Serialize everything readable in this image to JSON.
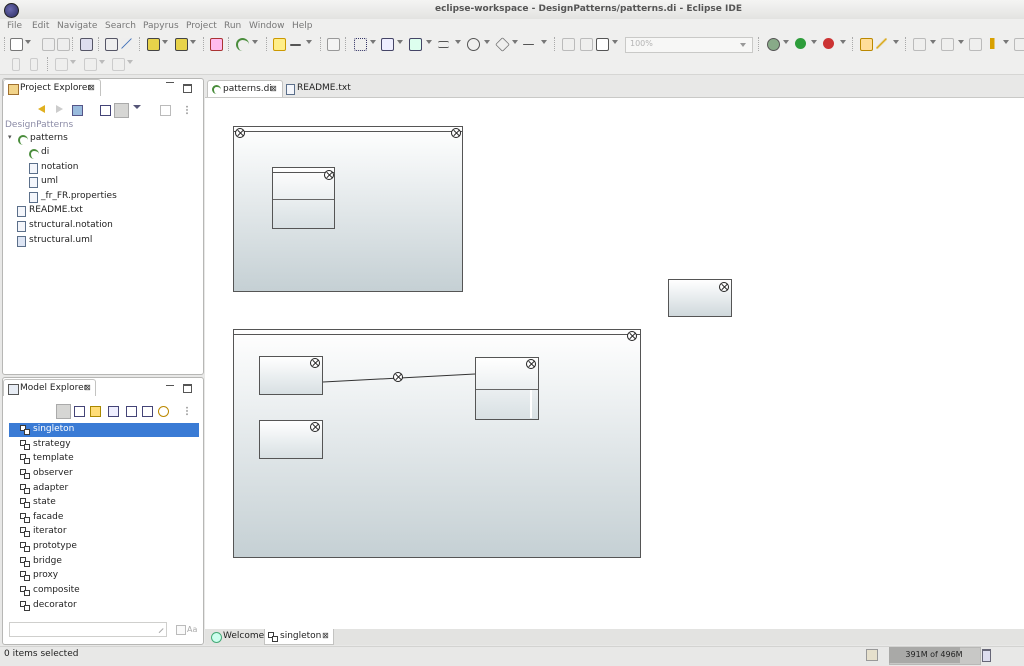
{
  "window": {
    "title": "eclipse-workspace - DesignPatterns/patterns.di - Eclipse IDE"
  },
  "menu": [
    "File",
    "Edit",
    "Navigate",
    "Search",
    "Papyrus",
    "Project",
    "Run",
    "Window",
    "Help"
  ],
  "toolbar": {
    "zoom_value": "100%"
  },
  "project_explorer": {
    "tab_label": "Project Explorer",
    "project_name": "DesignPatterns",
    "tree": [
      {
        "label": "patterns",
        "icon": "di-icon",
        "indent": 0,
        "expanded": true
      },
      {
        "label": "di",
        "icon": "di-icon",
        "indent": 1
      },
      {
        "label": "notation",
        "icon": "file-icon",
        "indent": 1
      },
      {
        "label": "uml",
        "icon": "file-icon",
        "indent": 1
      },
      {
        "label": "_fr_FR.properties",
        "icon": "file-icon",
        "indent": 1
      },
      {
        "label": "README.txt",
        "icon": "text-file-icon",
        "indent": 0
      },
      {
        "label": "structural.notation",
        "icon": "file-icon",
        "indent": 0
      },
      {
        "label": "structural.uml",
        "icon": "uml-file-icon",
        "indent": 0
      }
    ]
  },
  "model_explorer": {
    "tab_label": "Model Explorer",
    "items": [
      "singleton",
      "strategy",
      "template",
      "observer",
      "adapter",
      "state",
      "facade",
      "iterator",
      "prototype",
      "bridge",
      "proxy",
      "composite",
      "decorator"
    ],
    "selected_index": 0,
    "filter_placeholder": "",
    "aa_label": "Aa"
  },
  "editor": {
    "tabs": [
      {
        "label": "patterns.di",
        "active": true
      },
      {
        "label": "README.txt",
        "active": false
      }
    ],
    "bottom_tabs": [
      {
        "label": "Welcome",
        "active": false
      },
      {
        "label": "singleton",
        "active": true
      }
    ]
  },
  "status": {
    "message": "0 items selected",
    "heap": "391M of 496M",
    "heap_fraction": 0.79
  },
  "colors": {
    "selection": "#3a7bd5",
    "diagram_gradient_end": "#c5d0d4"
  }
}
